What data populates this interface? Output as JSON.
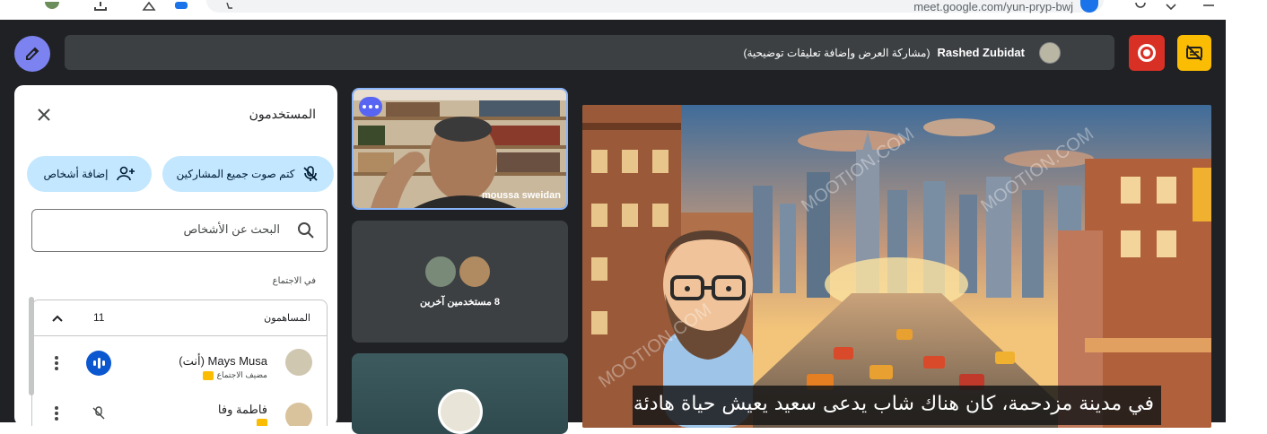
{
  "browser": {
    "url": "meet.google.com/yun-pryp-bwj"
  },
  "header": {
    "presenter_name": "Rashed Zubidat",
    "presenter_activity": "(مشاركة العرض وإضافة تعليقات توضيحية)"
  },
  "people_panel": {
    "title": "المستخدمون",
    "mute_all_label": "كتم صوت جميع المشاركين",
    "add_people_label": "إضافة أشخاص",
    "search_placeholder": "البحث عن الأشخاص",
    "section_label": "في الاجتماع",
    "group": {
      "label": "المساهمون",
      "count": "11"
    },
    "participants": [
      {
        "name": "Mays Musa (أنت)",
        "role": "مضيف الاجتماع",
        "speaking": true
      },
      {
        "name": "فاطمة وفا",
        "role": "",
        "speaking": false
      }
    ]
  },
  "tiles": {
    "tile1_name": "moussa sweidan",
    "others_label": "8 مستخدمين آخرين"
  },
  "shared_screen": {
    "watermark": "MOOTION.COM",
    "caption": "في مدينة مزدحمة، كان هناك شاب يدعى سعيد يعيش حياة هادئة."
  },
  "colors": {
    "meet_bg": "#202124",
    "accent_blue": "#0b57d0",
    "pill_blue": "#c2e7ff",
    "record_red": "#d93025",
    "caption_yellow": "#fbbc04",
    "pencil_purple": "#7c83f1"
  }
}
